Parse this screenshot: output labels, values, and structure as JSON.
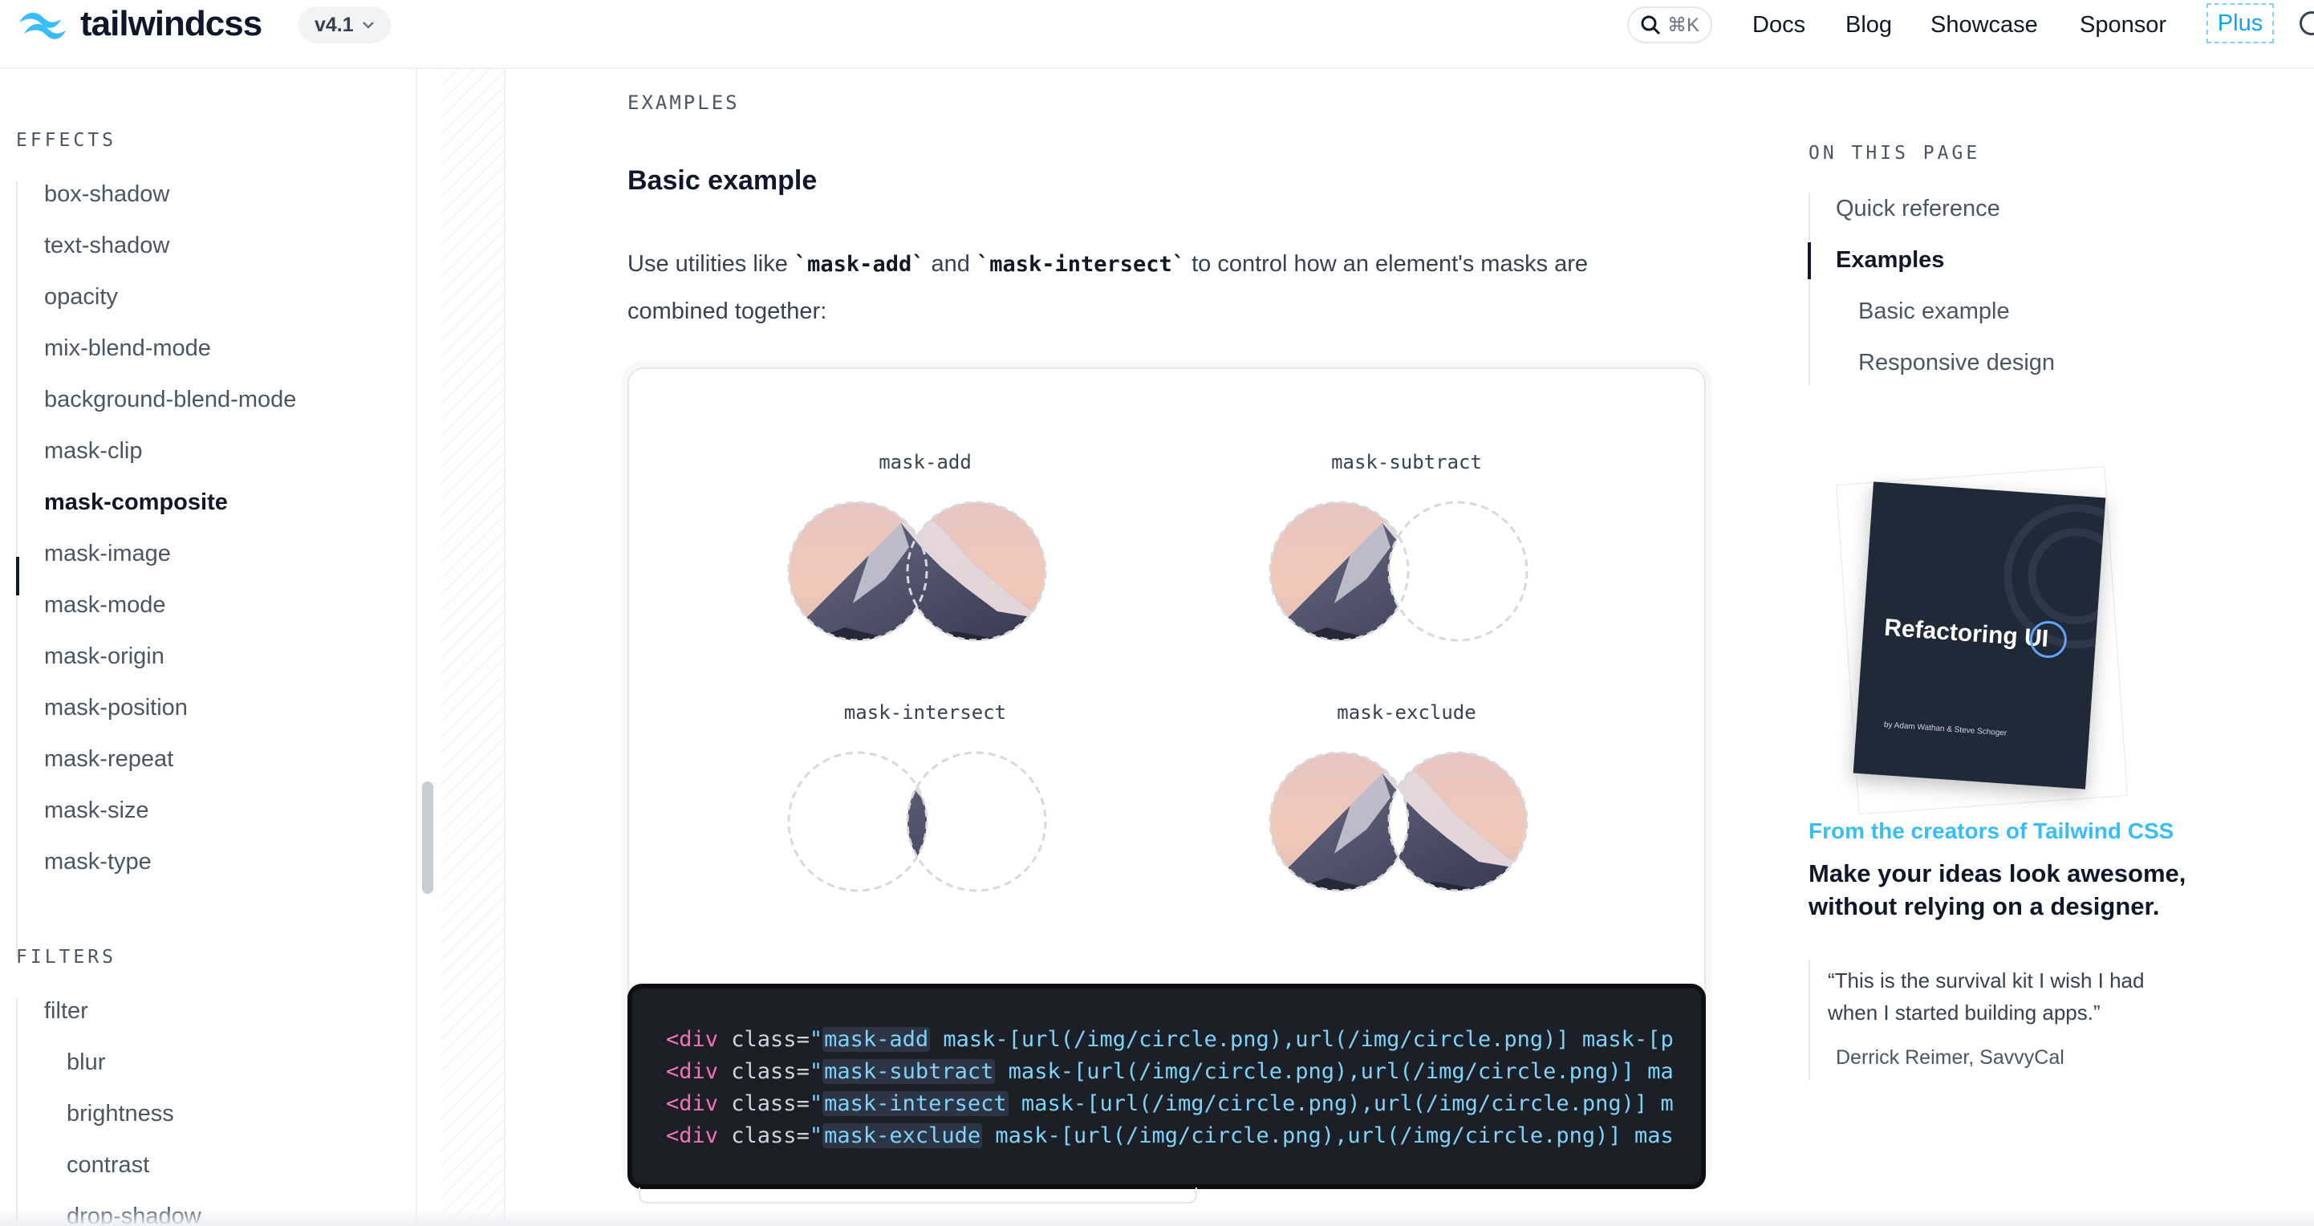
{
  "header": {
    "brand": "tailwindcss",
    "version": "v4.1",
    "search_shortcut": "⌘K",
    "nav": [
      "Docs",
      "Blog",
      "Showcase",
      "Sponsor"
    ],
    "plus": "Plus"
  },
  "sidebar": {
    "effects_title": "EFFECTS",
    "effects_items": [
      "box-shadow",
      "text-shadow",
      "opacity",
      "mix-blend-mode",
      "background-blend-mode",
      "mask-clip",
      "mask-composite",
      "mask-image",
      "mask-mode",
      "mask-origin",
      "mask-position",
      "mask-repeat",
      "mask-size",
      "mask-type"
    ],
    "active_item": "mask-composite",
    "filters_title": "FILTERS",
    "filters_items": [
      "filter",
      "blur",
      "brightness",
      "contrast",
      "drop-shadow"
    ]
  },
  "main": {
    "eyebrow": "EXAMPLES",
    "heading": "Basic example",
    "para_before": "Use utilities like ",
    "code1": "`mask-add`",
    "para_mid": " and ",
    "code2": "`mask-intersect`",
    "para_after": " to control how an element's masks are combined together:",
    "demos": [
      "mask-add",
      "mask-subtract",
      "mask-intersect",
      "mask-exclude"
    ],
    "code_lines": [
      {
        "tag": "<div",
        "attr": " class=",
        "q": "\"",
        "cls": "mask-add",
        "rest": " mask-[url(/img/circle.png),url(/img/circle.png)] mask-[p"
      },
      {
        "tag": "<div",
        "attr": " class=",
        "q": "\"",
        "cls": "mask-subtract",
        "rest": " mask-[url(/img/circle.png),url(/img/circle.png)] ma"
      },
      {
        "tag": "<div",
        "attr": " class=",
        "q": "\"",
        "cls": "mask-intersect",
        "rest": " mask-[url(/img/circle.png),url(/img/circle.png)] m"
      },
      {
        "tag": "<div",
        "attr": " class=",
        "q": "\"",
        "cls": "mask-exclude",
        "rest": " mask-[url(/img/circle.png),url(/img/circle.png)] mas"
      }
    ]
  },
  "toc": {
    "title": "ON THIS PAGE",
    "items": [
      "Quick reference",
      "Examples",
      "Basic example",
      "Responsive design"
    ],
    "active": "Examples"
  },
  "promo": {
    "book_title": "Refactoring",
    "book_title_ui": "UI",
    "book_authors": "by Adam Wathan & Steve Schoger",
    "eyebrow": "From the creators of Tailwind CSS",
    "title": "Make your ideas look awesome, without relying on a designer.",
    "quote": "“This is the survival kit I wish I had when I started building apps.”",
    "quote_author": "Derrick Reimer, SavvyCal"
  }
}
